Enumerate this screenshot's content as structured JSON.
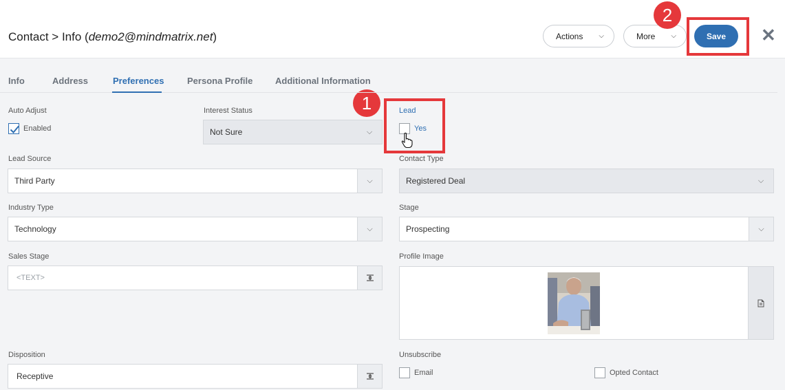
{
  "header": {
    "title_prefix": "Contact > Info (",
    "title_email": "demo2@mindmatrix.net",
    "title_suffix": ")",
    "actions_label": "Actions",
    "more_label": "More",
    "save_label": "Save",
    "close_glyph": "✕"
  },
  "tabs": [
    {
      "label": "Info"
    },
    {
      "label": "Address"
    },
    {
      "label": "Preferences"
    },
    {
      "label": "Persona Profile"
    },
    {
      "label": "Additional Information"
    }
  ],
  "active_tab": "Preferences",
  "annotations": {
    "step1": "1",
    "step2": "2"
  },
  "form": {
    "auto_adjust": {
      "label": "Auto Adjust",
      "option": "Enabled",
      "checked": true
    },
    "interest_status": {
      "label": "Interest Status",
      "value": "Not Sure"
    },
    "lead": {
      "label": "Lead",
      "option": "Yes",
      "checked": false
    },
    "lead_source": {
      "label": "Lead Source",
      "value": "Third Party"
    },
    "contact_type": {
      "label": "Contact Type",
      "value": "Registered Deal"
    },
    "industry_type": {
      "label": "Industry Type",
      "value": "Technology"
    },
    "stage": {
      "label": "Stage",
      "value": "Prospecting"
    },
    "sales_stage": {
      "label": "Sales Stage",
      "placeholder": "<TEXT>"
    },
    "profile_image": {
      "label": "Profile Image"
    },
    "disposition": {
      "label": "Disposition",
      "value": "Receptive"
    },
    "unsubscribe": {
      "label": "Unsubscribe",
      "email_option": "Email",
      "opted_option": "Opted Contact"
    }
  },
  "colors": {
    "accent": "#2f6fb2",
    "annotation": "#e5383b",
    "background": "#f3f4f6"
  }
}
